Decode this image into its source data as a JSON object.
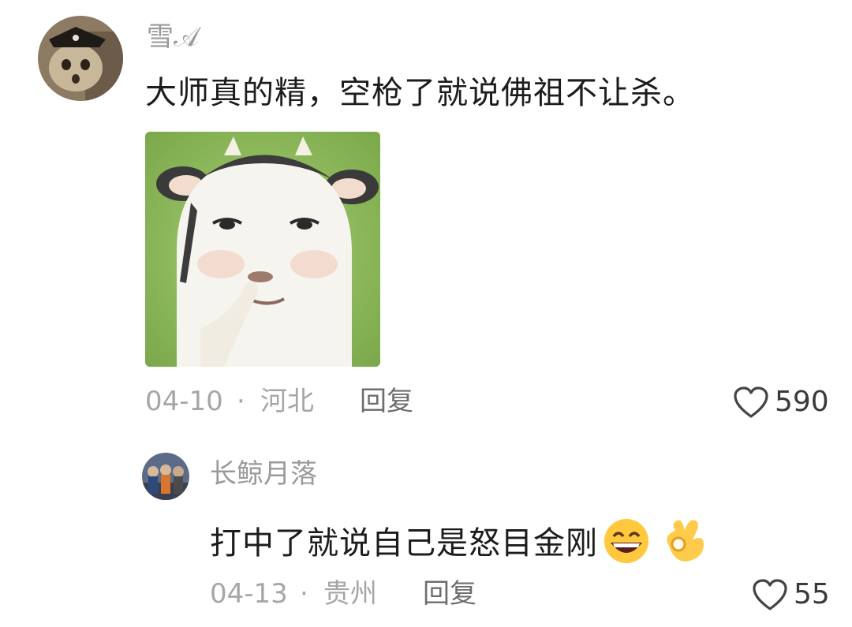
{
  "comments": [
    {
      "username": "雪𝒜",
      "text": "大师真的精，空枪了就说佛祖不让杀。",
      "date": "04-10",
      "separator": "·",
      "location": "河北",
      "reply_label": "回复",
      "likes": "590",
      "sticker": "cow-face-meme-sticker"
    },
    {
      "username": "长鲸月落",
      "text": "打中了就说自己是怒目金刚",
      "emojis": [
        "grinning-face-emoji",
        "ok-hand-emoji"
      ],
      "date": "04-13",
      "separator": "·",
      "location": "贵州",
      "reply_label": "回复",
      "likes": "55"
    }
  ],
  "icons": {
    "like": "heart-outline-icon"
  },
  "colors": {
    "username": "#9a9a9a",
    "text": "#1c1c1c",
    "meta": "#a6a6a6",
    "sticker_bg": "#8fbf5a"
  }
}
